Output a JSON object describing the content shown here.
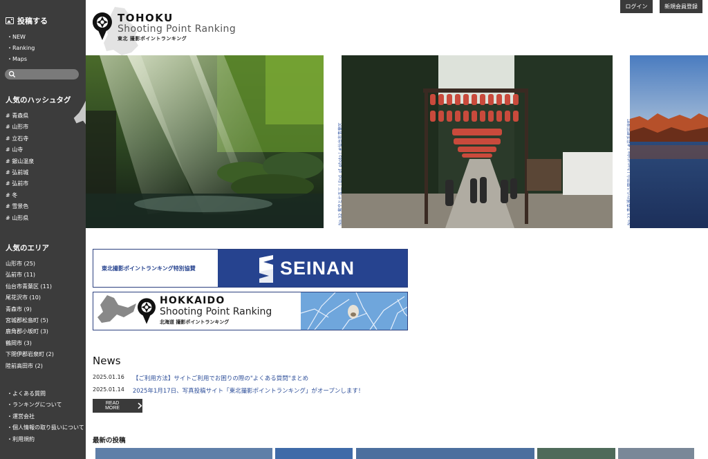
{
  "sidebar": {
    "post_label": "投稿する",
    "menu": [
      "・NEW",
      "・Ranking",
      "・Maps"
    ],
    "search_placeholder": "",
    "hashtags_heading": "人気のハッシュタグ",
    "hashtags": [
      "# 青森県",
      "# 山形市",
      "# 立石寺",
      "# 山寺",
      "# 銀山温泉",
      "# 弘前城",
      "# 弘前市",
      "# 冬",
      "# 雪景色",
      "# 山形県"
    ],
    "areas_heading": "人気のエリア",
    "areas": [
      "山形市 (25)",
      "弘前市 (11)",
      "仙台市青葉区 (11)",
      "尾花沢市 (10)",
      "青森市 (9)",
      "宮城郡松島町 (5)",
      "鹿角郡小坂町 (3)",
      "鶴岡市 (3)",
      "下閉伊郡岩泉町 (2)",
      "陸前高田市 (2)"
    ],
    "footer_links": [
      "・よくある質問",
      "・ランキングについて",
      "・運営会社",
      "・個人情報の取り扱いについて",
      "・利用規約"
    ]
  },
  "header": {
    "logo_title": "TOHOKU",
    "logo_subtitle": "Shooting Point Ranking",
    "logo_jp": "東北 撮影ポイントランキング",
    "login_label": "ログイン",
    "register_label": "新規会員登録"
  },
  "carousel": {
    "captions": [
      "No.32 紫空と七五三 | End_of_photo | #仙台市青葉区",
      "No.23 青森湖から八甲田山 | hanatake | #岩手郡岩泉町"
    ]
  },
  "banners": {
    "sponsor_text": "東北撮影ポイントランキング特別協賛",
    "sponsor_logo": "SEINAN",
    "hokkaido_title": "HOKKAIDO",
    "hokkaido_subtitle": "Shooting Point Ranking",
    "hokkaido_jp": "北海道 撮影ポイントランキング"
  },
  "news": {
    "title": "News",
    "items": [
      {
        "date": "2025.01.16",
        "text": "【ご利用方法】サイトご利用でお困りの際の\"よくある質問\"まとめ"
      },
      {
        "date": "2025.01.14",
        "text": "2025年1月17日、写真投稿サイト「東北撮影ポイントランキング」がオープンします！"
      }
    ],
    "read_more": "READ MORE"
  },
  "latest": {
    "title": "最新の投稿"
  },
  "colors": {
    "sidebar_bg": "#3c3c3c",
    "link_blue": "#2e4f9a",
    "seinan_blue": "#26438f"
  }
}
